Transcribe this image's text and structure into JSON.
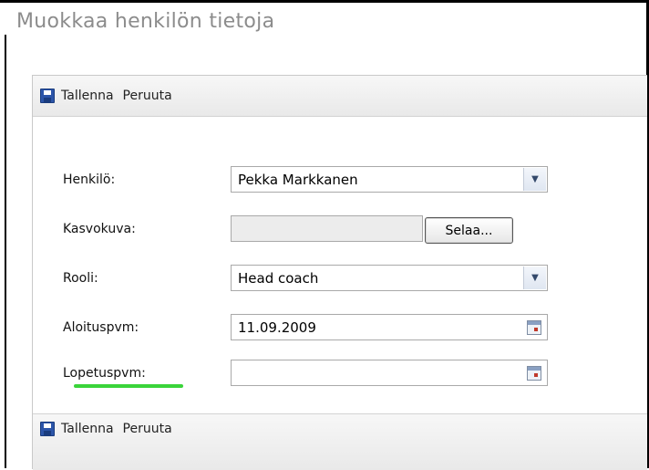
{
  "page": {
    "title": "Muokkaa henkilön tietoja"
  },
  "toolbar": {
    "save_label": "Tallenna",
    "cancel_label": "Peruuta"
  },
  "form": {
    "person": {
      "label": "Henkilö:",
      "value": "Pekka Markkanen"
    },
    "photo": {
      "label": "Kasvokuva:",
      "value": "",
      "browse_label": "Selaa..."
    },
    "role": {
      "label": "Rooli:",
      "value": "Head coach"
    },
    "start_date": {
      "label": "Aloituspvm:",
      "value": "11.09.2009"
    },
    "end_date": {
      "label": "Lopetuspvm:",
      "value": ""
    }
  },
  "icons": {
    "save": "save-icon",
    "dropdown": "chevron-down-icon",
    "calendar": "calendar-icon"
  },
  "colors": {
    "highlight_underline": "#3ad43a",
    "title_text": "#8c8c8c"
  }
}
